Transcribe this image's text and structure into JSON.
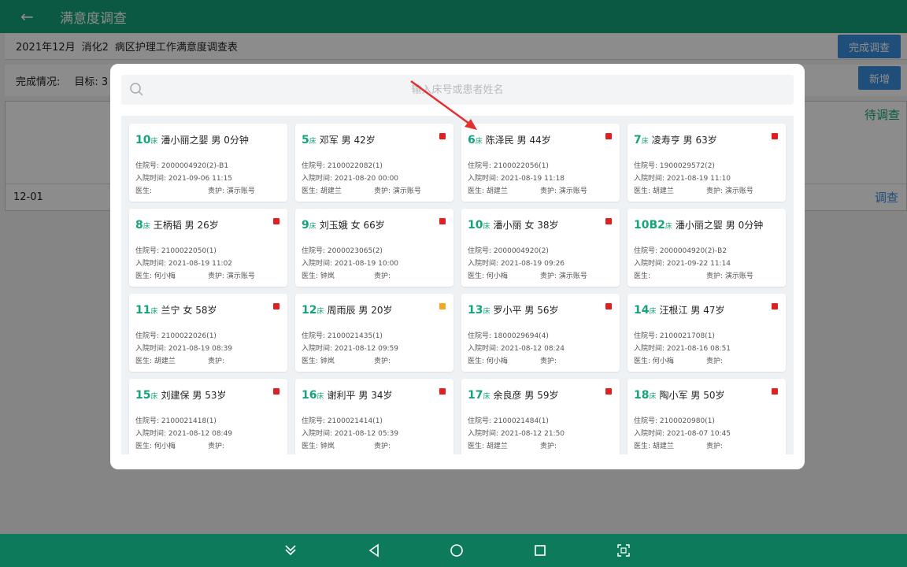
{
  "appbar": {
    "back_icon": "back-arrow-icon",
    "title": "满意度调查"
  },
  "subhead": {
    "month": "2021年12月",
    "ward": "消化2",
    "survey_name": "病区护理工作满意度调查表",
    "finish_label": "完成调查"
  },
  "status": {
    "completion_label": "完成情况:",
    "target_label": "目标: 3",
    "add_label": "新增"
  },
  "table": {
    "pending_label": "待调查",
    "row_date": "12-01",
    "row_action": "调查"
  },
  "search": {
    "placeholder": "输入床号或患者姓名",
    "value": ""
  },
  "labels": {
    "bed_unit": "床",
    "admission_no": "住院号:",
    "admission_time": "入院时间:",
    "doctor": "医生:",
    "nurse": "责护:"
  },
  "colors": {
    "accent": "#14a37a",
    "flag_red": "#e02020",
    "flag_orange": "#f5a623"
  },
  "patients": [
    {
      "bed": "10",
      "name": "潘小丽之婴",
      "sex": "男",
      "age": "0分钟",
      "flag": "",
      "admission_no": "2000004920(2)-B1",
      "admission_time": "2021-09-06 11:15",
      "doctor": "",
      "nurse": "演示账号"
    },
    {
      "bed": "5",
      "name": "邓军",
      "sex": "男",
      "age": "42岁",
      "flag": "red",
      "admission_no": "2100022082(1)",
      "admission_time": "2021-08-20 00:00",
      "doctor": "胡建兰",
      "nurse": "演示账号"
    },
    {
      "bed": "6",
      "name": "陈泽民",
      "sex": "男",
      "age": "44岁",
      "flag": "red",
      "admission_no": "2100022056(1)",
      "admission_time": "2021-08-19 11:18",
      "doctor": "胡建兰",
      "nurse": "演示账号"
    },
    {
      "bed": "7",
      "name": "凌寿亨",
      "sex": "男",
      "age": "63岁",
      "flag": "red",
      "admission_no": "1900029572(2)",
      "admission_time": "2021-08-19 11:10",
      "doctor": "胡建兰",
      "nurse": "演示账号"
    },
    {
      "bed": "8",
      "name": "王柄韬",
      "sex": "男",
      "age": "26岁",
      "flag": "red",
      "admission_no": "2100022050(1)",
      "admission_time": "2021-08-19 11:02",
      "doctor": "何小梅",
      "nurse": "演示账号"
    },
    {
      "bed": "9",
      "name": "刘玉娥",
      "sex": "女",
      "age": "66岁",
      "flag": "red",
      "admission_no": "2000023065(2)",
      "admission_time": "2021-08-19 10:00",
      "doctor": "钟岚",
      "nurse": ""
    },
    {
      "bed": "10",
      "name": "潘小丽",
      "sex": "女",
      "age": "38岁",
      "flag": "red",
      "admission_no": "2000004920(2)",
      "admission_time": "2021-08-19 09:26",
      "doctor": "何小梅",
      "nurse": "演示账号"
    },
    {
      "bed": "10B2",
      "name": "潘小丽之婴",
      "sex": "男",
      "age": "0分钟",
      "flag": "",
      "admission_no": "2000004920(2)-B2",
      "admission_time": "2021-09-22 11:14",
      "doctor": "",
      "nurse": "演示账号"
    },
    {
      "bed": "11",
      "name": "兰宁",
      "sex": "女",
      "age": "58岁",
      "flag": "red",
      "admission_no": "2100022026(1)",
      "admission_time": "2021-08-19 08:39",
      "doctor": "胡建兰",
      "nurse": ""
    },
    {
      "bed": "12",
      "name": "周雨辰",
      "sex": "男",
      "age": "20岁",
      "flag": "orange",
      "admission_no": "2100021435(1)",
      "admission_time": "2021-08-12 09:59",
      "doctor": "钟岚",
      "nurse": ""
    },
    {
      "bed": "13",
      "name": "罗小平",
      "sex": "男",
      "age": "56岁",
      "flag": "red",
      "admission_no": "1800029694(4)",
      "admission_time": "2021-08-12 08:24",
      "doctor": "何小梅",
      "nurse": ""
    },
    {
      "bed": "14",
      "name": "汪根江",
      "sex": "男",
      "age": "47岁",
      "flag": "red",
      "admission_no": "2100021708(1)",
      "admission_time": "2021-08-16 08:51",
      "doctor": "何小梅",
      "nurse": ""
    },
    {
      "bed": "15",
      "name": "刘建保",
      "sex": "男",
      "age": "53岁",
      "flag": "red",
      "admission_no": "2100021418(1)",
      "admission_time": "2021-08-12 08:49",
      "doctor": "何小梅",
      "nurse": ""
    },
    {
      "bed": "16",
      "name": "谢利平",
      "sex": "男",
      "age": "34岁",
      "flag": "red",
      "admission_no": "2100021414(1)",
      "admission_time": "2021-08-12 05:39",
      "doctor": "钟岚",
      "nurse": ""
    },
    {
      "bed": "17",
      "name": "余良彦",
      "sex": "男",
      "age": "59岁",
      "flag": "red",
      "admission_no": "2100021484(1)",
      "admission_time": "2021-08-12 21:50",
      "doctor": "胡建兰",
      "nurse": ""
    },
    {
      "bed": "18",
      "name": "陶小军",
      "sex": "男",
      "age": "50岁",
      "flag": "red",
      "admission_no": "2100020980(1)",
      "admission_time": "2021-08-07 10:45",
      "doctor": "胡建兰",
      "nurse": ""
    }
  ],
  "navbar": {
    "icons": [
      "collapse-chevron-icon",
      "back-triangle-icon",
      "home-circle-icon",
      "recents-square-icon",
      "screenshot-icon"
    ]
  }
}
